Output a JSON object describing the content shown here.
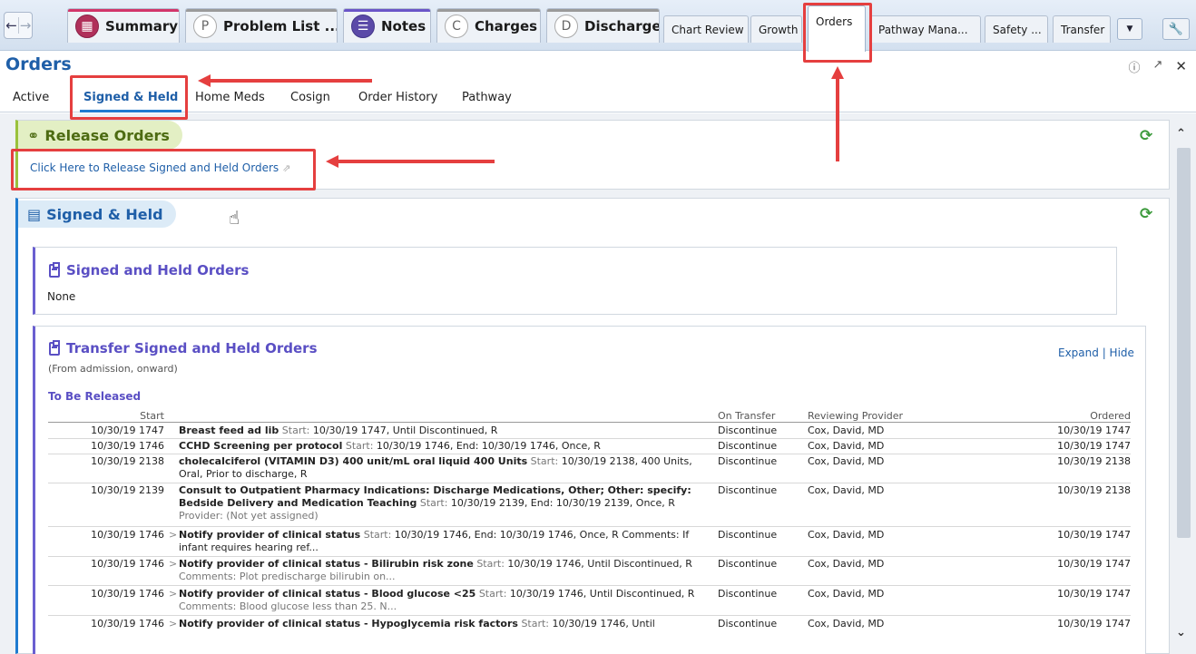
{
  "tabs": [
    {
      "label": "Summary",
      "icon": "summary-app-icon",
      "color": "#b0305a"
    },
    {
      "label": "Problem List ...",
      "icon_letter": "P",
      "color": "#8a8a8a"
    },
    {
      "label": "Notes",
      "icon": "notes-icon",
      "color": "#5b4aa8"
    },
    {
      "label": "Charges",
      "icon_letter": "C",
      "color": "#8a8a8a"
    },
    {
      "label": "Discharge",
      "icon_letter": "D",
      "color": "#8a8a8a"
    },
    {
      "label": "Chart Review"
    },
    {
      "label": "Growth"
    },
    {
      "label": "Orders",
      "active": true
    },
    {
      "label": "Pathway Mana..."
    },
    {
      "label": "Safety ..."
    },
    {
      "label": "Transfer"
    }
  ],
  "activity": {
    "title": "Orders",
    "subtabs": [
      "Active",
      "Signed & Held",
      "Home Meds",
      "Cosign",
      "Order History",
      "Pathway"
    ],
    "active_subtab": "Signed & Held"
  },
  "release": {
    "title": "Release Orders",
    "link": "Click Here to Release Signed and Held Orders"
  },
  "signed_held": {
    "title": "Signed & Held",
    "orders_title": "Signed and Held Orders",
    "orders_value": "None",
    "transfer_title": "Transfer Signed and Held Orders",
    "transfer_subtitle": "(From admission, onward)",
    "expand_hide": "Expand | Hide",
    "to_be_released": "To Be Released",
    "columns": {
      "start": "Start",
      "on_transfer": "On Transfer",
      "reviewing_provider": "Reviewing Provider",
      "ordered": "Ordered"
    },
    "rows": [
      {
        "start": "10/30/19 1747",
        "arrow": "",
        "name": "Breast feed ad lib",
        "detail_label": "Start:",
        "detail": " 10/30/19 1747, Until Discontinued, R",
        "extra": "",
        "transfer": "Discontinue",
        "provider": "Cox, David, MD",
        "ordered": "10/30/19 1747"
      },
      {
        "start": "10/30/19 1746",
        "arrow": "",
        "name": "CCHD Screening per protocol",
        "detail_label": "Start:",
        "detail": " 10/30/19 1746, End: 10/30/19 1746, Once, R",
        "extra": "",
        "transfer": "Discontinue",
        "provider": "Cox, David, MD",
        "ordered": "10/30/19 1747"
      },
      {
        "start": "10/30/19 2138",
        "arrow": "",
        "name": "cholecalciferol (VITAMIN D3) 400 unit/mL oral liquid 400 Units",
        "detail_label": "Start:",
        "detail": " 10/30/19 2138, 400 Units, Oral, Prior to discharge, R",
        "extra": "",
        "transfer": "Discontinue",
        "provider": "Cox, David, MD",
        "ordered": "10/30/19 2138"
      },
      {
        "start": "10/30/19 2139",
        "arrow": "",
        "name": "Consult to Outpatient Pharmacy Indications: Discharge Medications, Other; Other: specify: Bedside Delivery and Medication Teaching",
        "detail_label": "Start:",
        "detail": " 10/30/19 2139, End: 10/30/19 2139, Once, R",
        "extra": "Provider: (Not yet assigned)",
        "transfer": "Discontinue",
        "provider": "Cox, David, MD",
        "ordered": "10/30/19 2138"
      },
      {
        "start": "10/30/19 1746",
        "arrow": ">",
        "name": "Notify provider of clinical status",
        "detail_label": "Start:",
        "detail": " 10/30/19 1746, End: 10/30/19 1746, Once, R  Comments: If infant requires hearing ref...",
        "extra": "",
        "transfer": "Discontinue",
        "provider": "Cox, David, MD",
        "ordered": "10/30/19 1747"
      },
      {
        "start": "10/30/19 1746",
        "arrow": ">",
        "name": "Notify provider of clinical status - Bilirubin risk zone",
        "detail_label": "Start:",
        "detail": " 10/30/19 1746, Until Discontinued, R",
        "extra": "Comments: Plot predischarge bilirubin on...",
        "transfer": "Discontinue",
        "provider": "Cox, David, MD",
        "ordered": "10/30/19 1747"
      },
      {
        "start": "10/30/19 1746",
        "arrow": ">",
        "name": "Notify provider of clinical status - Blood glucose <25",
        "detail_label": "Start:",
        "detail": " 10/30/19 1746, Until Discontinued, R",
        "extra": "Comments: Blood glucose less than 25. N...",
        "transfer": "Discontinue",
        "provider": "Cox, David, MD",
        "ordered": "10/30/19 1747"
      },
      {
        "start": "10/30/19 1746",
        "arrow": ">",
        "name": "Notify provider of clinical status - Hypoglycemia risk factors",
        "detail_label": "Start:",
        "detail": " 10/30/19 1746, Until",
        "extra": "",
        "transfer": "Discontinue",
        "provider": "Cox, David, MD",
        "ordered": "10/30/19 1747"
      }
    ]
  },
  "colors": {
    "accent": "#1f5fa8",
    "section_purple": "#5a4fc4",
    "callout_red": "#e53f3f",
    "refresh_green": "#3b9a3b"
  }
}
